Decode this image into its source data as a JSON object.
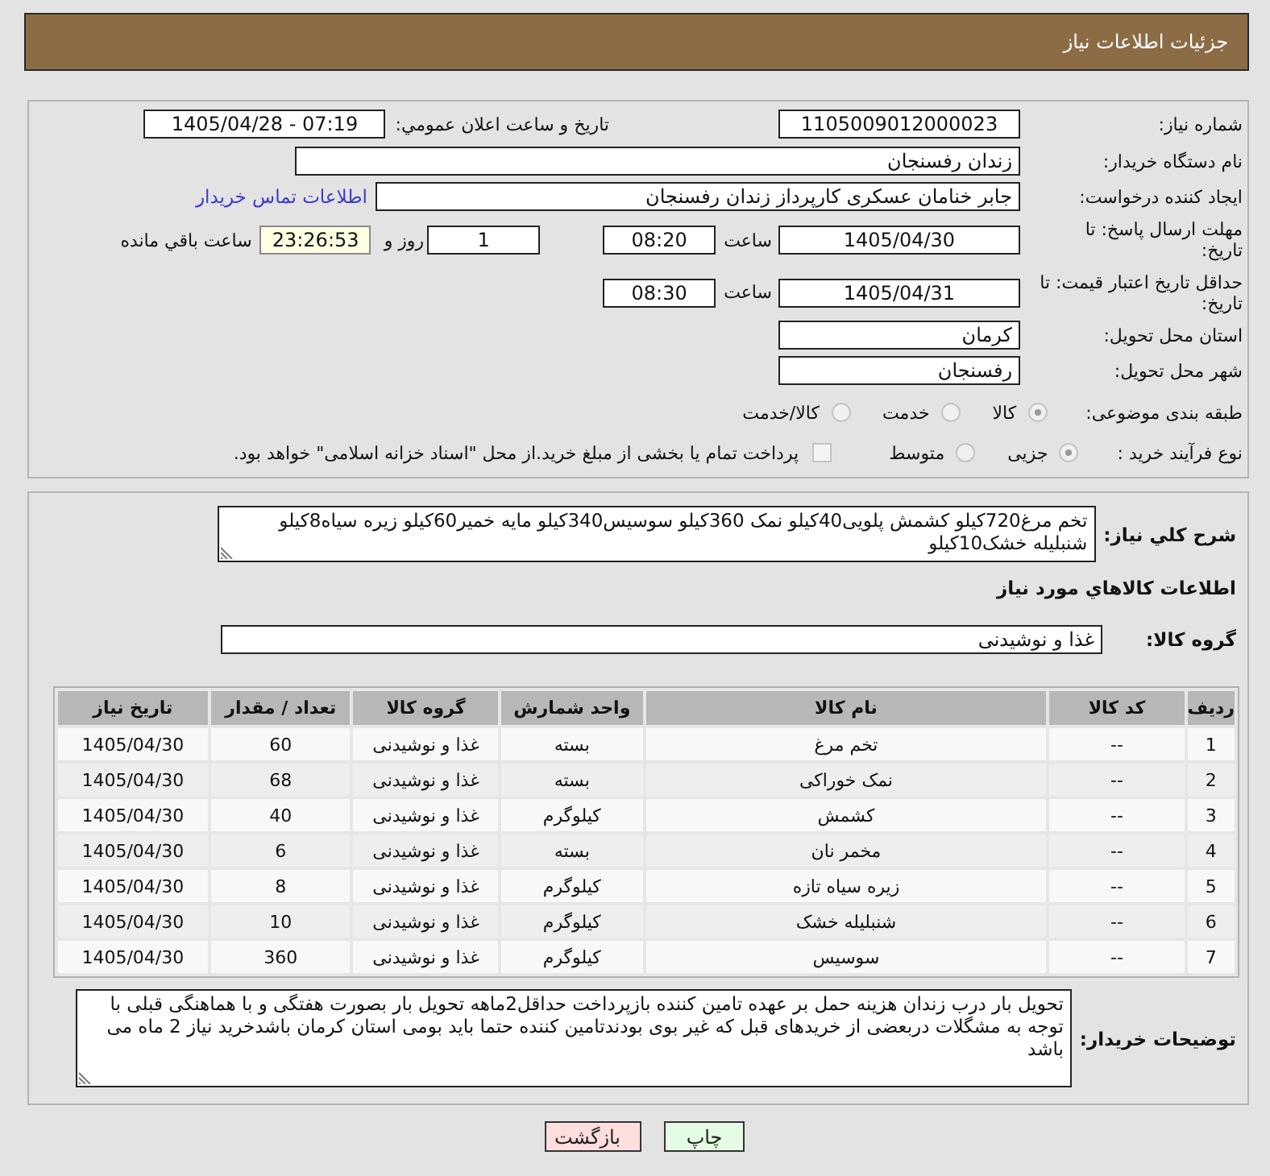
{
  "header": {
    "title": "جزئیات اطلاعات نیاز"
  },
  "details": {
    "need_number": {
      "label": "شماره نیاز:",
      "value": "1105009012000023"
    },
    "announcement": {
      "label": "تاریخ و ساعت اعلان عمومي:",
      "value": "1405/04/28 - 07:19"
    },
    "buyer_org": {
      "label": "نام دستگاه خریدار:",
      "value": "زندان رفسنجان"
    },
    "requester": {
      "label": "ایجاد کننده درخواست:",
      "value": "جابر خنامان عسکری کارپرداز زندان رفسنجان",
      "contact_link": "اطلاعات تماس خریدار"
    },
    "reply_deadline": {
      "label": "مهلت ارسال پاسخ: تا تاریخ:",
      "date": "1405/04/30",
      "time_label": "ساعت",
      "time": "08:20",
      "days": "1",
      "days_label": "روز و",
      "remaining": "23:26:53",
      "remaining_label": "ساعت باقي مانده"
    },
    "price_validity": {
      "label": "حداقل تاریخ اعتبار قیمت: تا تاریخ:",
      "date": "1405/04/31",
      "time_label": "ساعت",
      "time": "08:30"
    },
    "province": {
      "label": "استان محل تحویل:",
      "value": "کرمان"
    },
    "city": {
      "label": "شهر محل تحویل:",
      "value": "رفسنجان"
    },
    "category": {
      "label": "طبقه بندی موضوعی:",
      "options": [
        {
          "label": "کالا",
          "selected": true
        },
        {
          "label": "خدمت",
          "selected": false
        },
        {
          "label": "کالا/خدمت",
          "selected": false
        }
      ]
    },
    "process": {
      "label": "نوع فرآیند خرید :",
      "options": [
        {
          "label": "جزیی",
          "selected": true
        },
        {
          "label": "متوسط",
          "selected": false
        }
      ],
      "treasury": {
        "label": "پرداخت تمام یا بخشی از مبلغ خرید.از محل \"اسناد خزانه اسلامی\" خواهد بود.",
        "checked": false
      }
    }
  },
  "description": {
    "label": "شرح کلي نياز:",
    "value": "تخم مرغ720کیلو کشمش پلویی40کیلو نمک 360کیلو سوسیس340کیلو مایه خمیر60کیلو زیره سیاه8کیلو شنبلیله خشک10کیلو"
  },
  "goods": {
    "heading": "اطلاعات کالاهاي مورد نياز",
    "group_label": "گروه کالا:",
    "group_value": "غذا و نوشیدنی"
  },
  "table": {
    "columns": [
      "ردیف",
      "کد کالا",
      "نام کالا",
      "واحد شمارش",
      "گروه کالا",
      "تعداد / مقدار",
      "تاریخ نیاز"
    ],
    "rows": [
      [
        "1",
        "--",
        "تخم مرغ",
        "بسته",
        "غذا و نوشیدنی",
        "60",
        "1405/04/30"
      ],
      [
        "2",
        "--",
        "نمک خوراکی",
        "بسته",
        "غذا و نوشیدنی",
        "68",
        "1405/04/30"
      ],
      [
        "3",
        "--",
        "کشمش",
        "کیلوگرم",
        "غذا و نوشیدنی",
        "40",
        "1405/04/30"
      ],
      [
        "4",
        "--",
        "مخمر نان",
        "بسته",
        "غذا و نوشیدنی",
        "6",
        "1405/04/30"
      ],
      [
        "5",
        "--",
        "زیره سیاه تازه",
        "کیلوگرم",
        "غذا و نوشیدنی",
        "8",
        "1405/04/30"
      ],
      [
        "6",
        "--",
        "شنبلیله خشک",
        "کیلوگرم",
        "غذا و نوشیدنی",
        "10",
        "1405/04/30"
      ],
      [
        "7",
        "--",
        "سوسیس",
        "کیلوگرم",
        "غذا و نوشیدنی",
        "360",
        "1405/04/30"
      ]
    ]
  },
  "notes": {
    "label": "توضیحات خریدار:",
    "value": "تحویل بار درب زندان هزینه حمل بر عهده تامین کننده بازپرداخت حداقل2ماهه تحویل بار بصورت هفتگی و با هماهنگی قبلی با توجه به مشگلات دربعضی از خریدهای قبل که غیر بوی بودندتامین کننده حتما باید بومی استان کرمان باشدخرید نیاز 2 ماه می باشد"
  },
  "buttons": [
    {
      "label": "چاپ",
      "kind": "print"
    },
    {
      "label": "بازگشت",
      "kind": "back"
    }
  ]
}
